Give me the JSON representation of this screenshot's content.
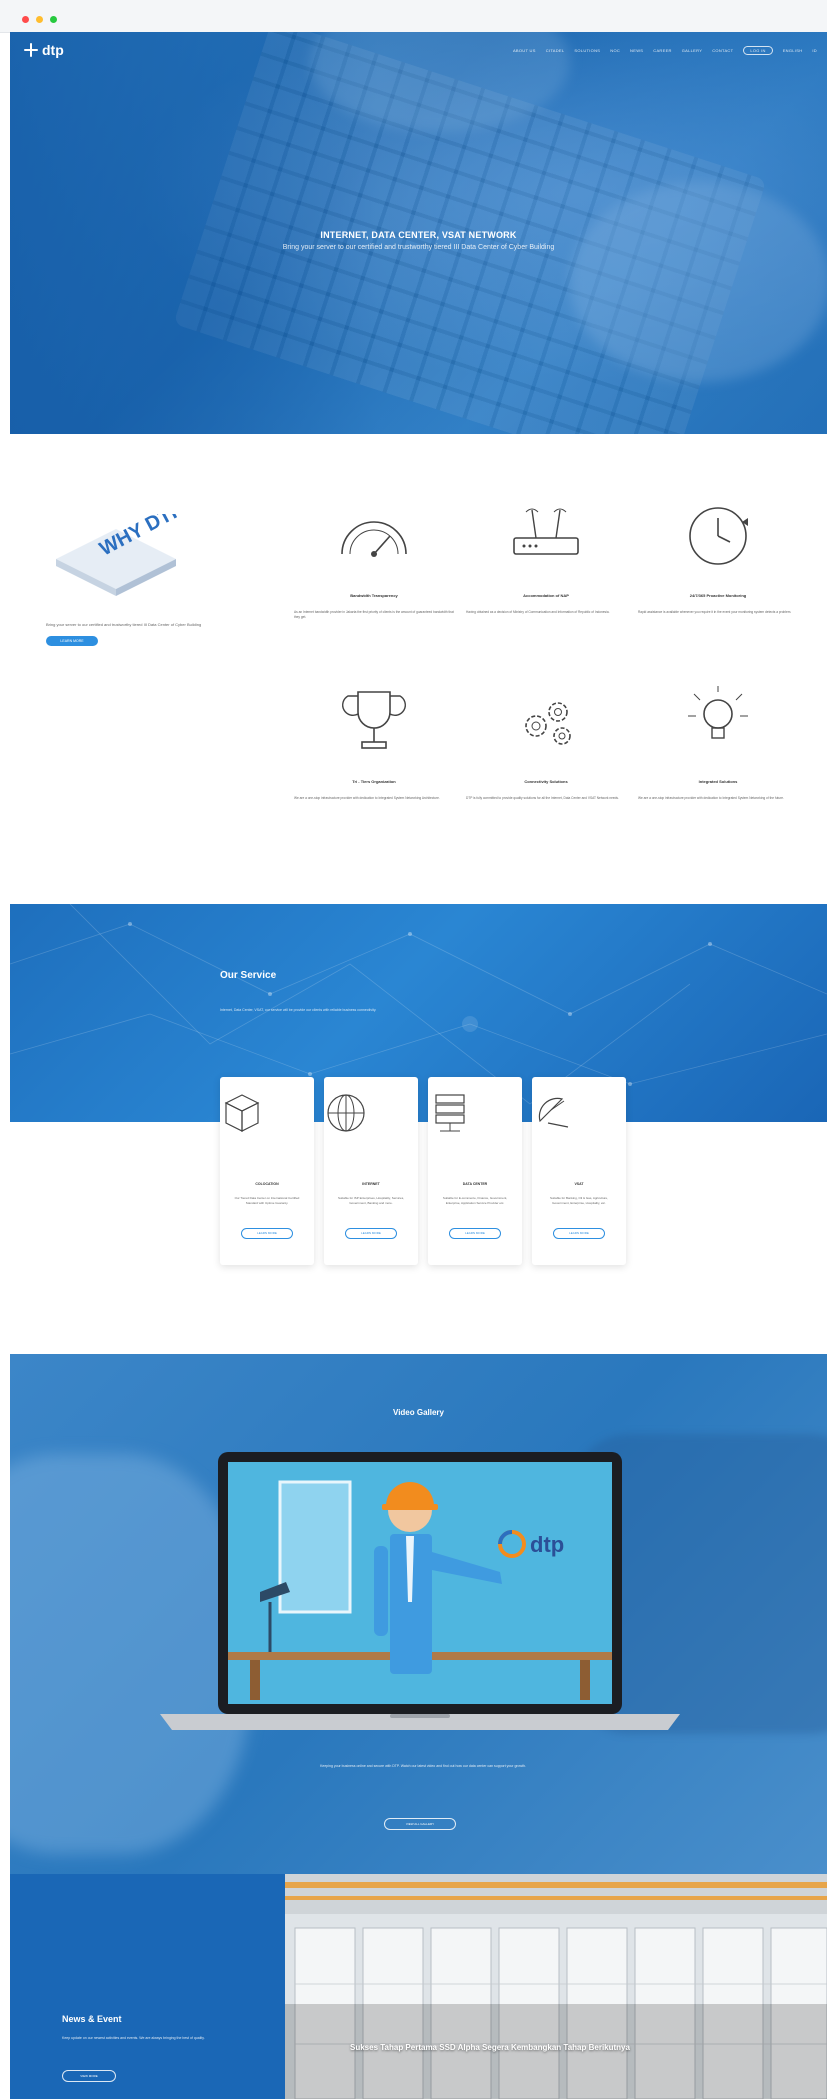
{
  "nav": {
    "logo": "dtp",
    "links": [
      "ABOUT US",
      "CITADEL",
      "SOLUTIONS",
      "NOC",
      "NEWS",
      "CAREER",
      "GALLERY",
      "CONTACT",
      "LOG IN",
      "ENGLISH",
      "ID"
    ]
  },
  "hero": {
    "title": "INTERNET, DATA CENTER, VSAT NETWORK",
    "subtitle": "Bring your server to our certified and trustworthy tiered III Data Center of Cyber Building"
  },
  "why": {
    "badge": "WHY DTP",
    "text": "Bring your server to our certified and trustworthy tiered III Data Center of Cyber Building",
    "button": "LEARN MORE",
    "features": [
      {
        "icon": "speedometer-icon",
        "title": "Bandwidth Transparency",
        "desc": "As an Internet bandwidth provider in Jakarta the first priority of clients is the amount of guaranteed bandwidth that they get."
      },
      {
        "icon": "router-icon",
        "title": "Accommodation of NAP",
        "desc": "Having obtained as a decision of Ministry of Communication and Information of Republic of Indonesia."
      },
      {
        "icon": "clock-icon",
        "title": "24/7/365 Proactive Monitoring",
        "desc": "Rapid assistance is available whenever you require it in the event your monitoring system detects a problem."
      },
      {
        "icon": "trophy-icon",
        "title": "Tri - Tiers Organization",
        "desc": "We are a one-stop infrastructure provider with dedication to Integrated System Networking Architecture."
      },
      {
        "icon": "gears-icon",
        "title": "Connectivity Solutions",
        "desc": "DTP is fully committed to provide quality solutions for all the Internet, Data Center and VSAT Network needs."
      },
      {
        "icon": "lightbulb-icon",
        "title": "Integrated Solutions",
        "desc": "We are a one-stop infrastructure provider with dedication to Integrated System Networking of the future."
      }
    ]
  },
  "service": {
    "title": "Our Service",
    "subtitle": "Internet, Data Center, VSAT, our service will be provide our clients with reliable business connectivity.",
    "cards": [
      {
        "icon": "server-box-icon",
        "title": "COLOCATION",
        "desc": "Our Tiered Data Center on International Certified Standard with Uptime Guaranty.",
        "button": "LEARN MORE"
      },
      {
        "icon": "globe-icon",
        "title": "INTERNET",
        "desc": "Suitable for ISP Enterprises, Hospitality, Services, Government, Banking and more.",
        "button": "LEARN MORE"
      },
      {
        "icon": "rack-icon",
        "title": "DATA CENTER",
        "desc": "Suitable for E-commerce, Finance, Government, Enterprise, Application Service Provider etc.",
        "button": "LEARN MORE"
      },
      {
        "icon": "satellite-dish-icon",
        "title": "VSAT",
        "desc": "Suitable for Banking, Oil & Gas, Agriculture, Government, Enterprise, Hospitality, etc.",
        "button": "LEARN MORE"
      }
    ]
  },
  "video": {
    "title": "Video Gallery",
    "desc": "Keeping your business online and secure with DTP. Watch our latest video and find out how our data center can support your growth.",
    "button": "VIEW ALL GALLERY",
    "screen_logo": "dtp"
  },
  "news": {
    "title": "News & Event",
    "desc": "Keep update on our newest activities and events. We are always bringing the best of quality.",
    "button": "VIEW MORE",
    "headline": "Sukses Tahap Pertama  SSD Alpha Segera Kembangkan Tahap Berikutnya"
  }
}
